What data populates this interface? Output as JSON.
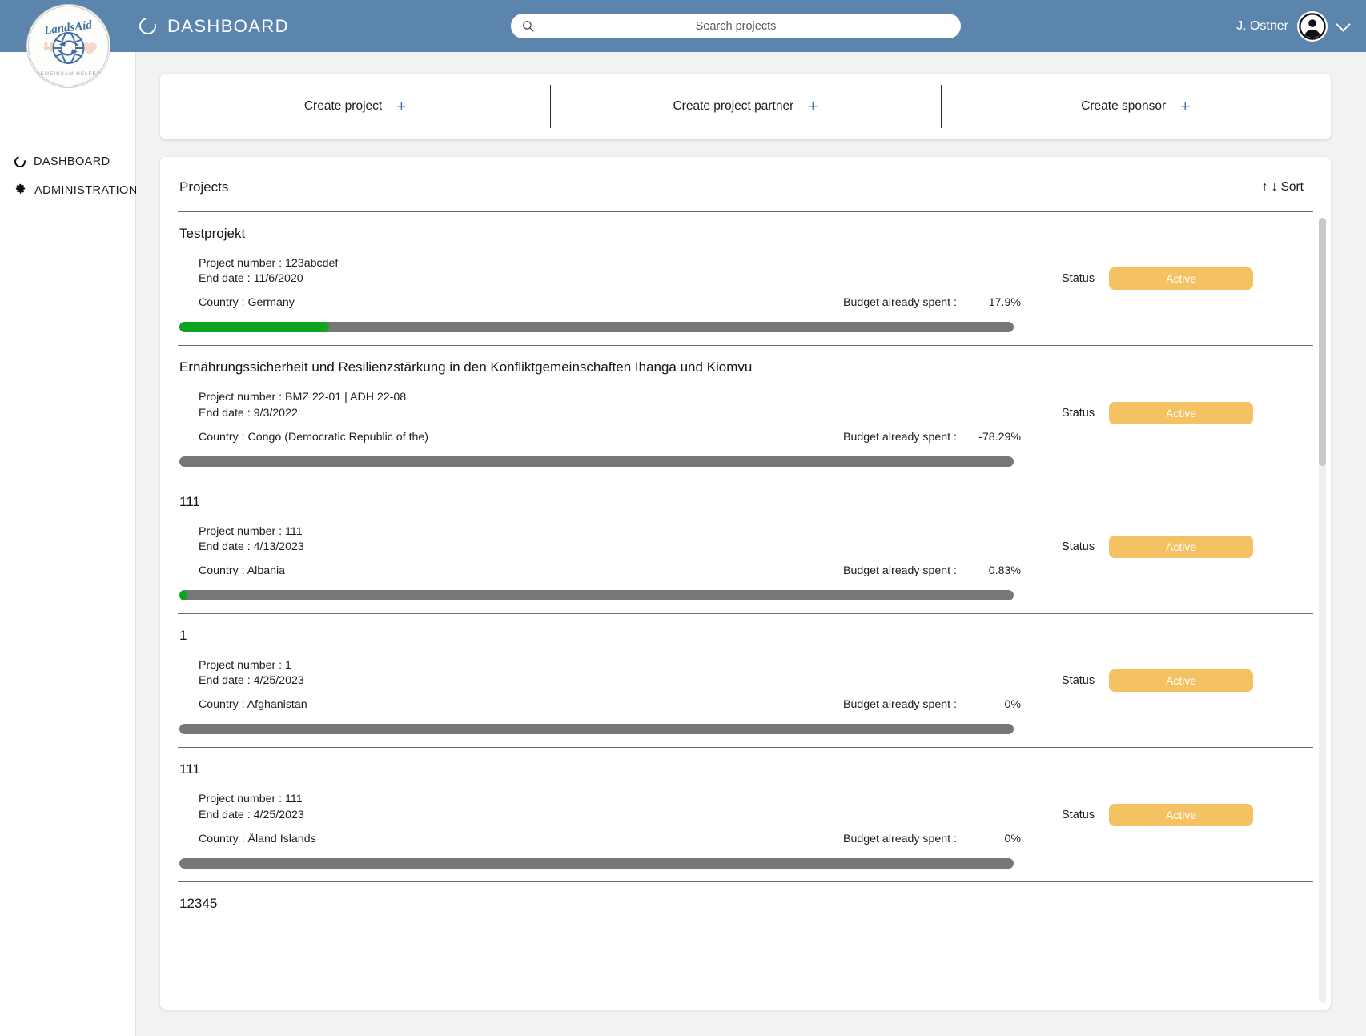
{
  "header": {
    "title": "DASHBOARD",
    "title_icon": "ring-icon",
    "search": {
      "placeholder": "Search projects",
      "value": "",
      "icon": "search-icon"
    },
    "user": {
      "name": "J. Ostner",
      "avatar_icon": "account-circle-icon",
      "menu_icon": "chevron-down-icon"
    },
    "bar_color": "#5b85ad"
  },
  "brand": {
    "name": "LandsAid",
    "tagline": "GEMEINSAM HELFEN"
  },
  "sidebar": {
    "items": [
      {
        "label": "DASHBOARD",
        "icon": "ring-icon"
      },
      {
        "label": "ADMINISTRATION",
        "icon": "gear-icon"
      }
    ]
  },
  "quick_actions": [
    {
      "label": "Create project",
      "icon": "plus-icon"
    },
    {
      "label": "Create project partner",
      "icon": "plus-icon"
    },
    {
      "label": "Create sponsor",
      "icon": "plus-icon"
    }
  ],
  "projects_panel": {
    "title": "Projects",
    "sort": {
      "label": "Sort",
      "up_icon": "arrow-up-icon",
      "down_icon": "arrow-down-icon",
      "up_glyph": "↑",
      "down_glyph": "↓"
    },
    "labels": {
      "project_number": "Project number :",
      "end_date": "End date :",
      "country": "Country :",
      "budget_spent": "Budget already spent :",
      "status": "Status"
    },
    "colors": {
      "bar_fill": "#0da520",
      "bar_track": "#777777",
      "status_active": "#f5c263"
    },
    "rows": [
      {
        "name": "Testprojekt",
        "project_number": "123abcdef",
        "end_date": "11/6/2020",
        "country": "Germany",
        "budget_spent": "17.9%",
        "budget_spent_value": 17.9,
        "status": "Active"
      },
      {
        "name": "Ernährungssicherheit und Resilienzstärkung in den Konfliktgemeinschaften Ihanga und Kiomvu",
        "project_number": "BMZ 22-01 | ADH 22-08",
        "end_date": "9/3/2022",
        "country": "Congo (Democratic Republic of the)",
        "budget_spent": "-78.29%",
        "budget_spent_value": 0,
        "status": "Active"
      },
      {
        "name": "111",
        "project_number": "111",
        "end_date": "4/13/2023",
        "country": "Albania",
        "budget_spent": "0.83%",
        "budget_spent_value": 0.83,
        "status": "Active"
      },
      {
        "name": "1",
        "project_number": "1",
        "end_date": "4/25/2023",
        "country": "Afghanistan",
        "budget_spent": "0%",
        "budget_spent_value": 0,
        "status": "Active"
      },
      {
        "name": "111",
        "project_number": "111",
        "end_date": "4/25/2023",
        "country": "Åland Islands",
        "budget_spent": "0%",
        "budget_spent_value": 0,
        "status": "Active"
      }
    ],
    "partial_row": {
      "name": "12345"
    }
  }
}
